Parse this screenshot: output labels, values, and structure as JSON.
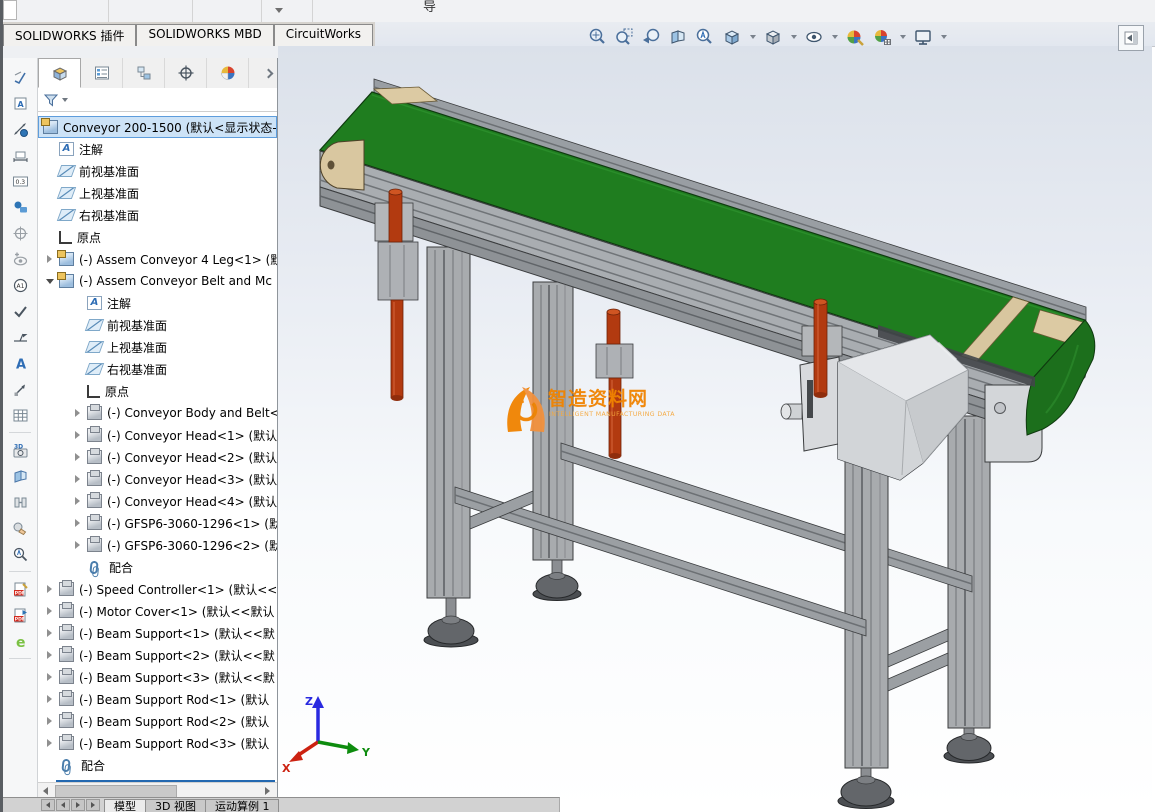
{
  "topbar": {
    "hint_char": "导"
  },
  "ribbon_tabs": [
    {
      "label": "SOLIDWORKS 插件"
    },
    {
      "label": "SOLIDWORKS MBD"
    },
    {
      "label": "CircuitWorks"
    }
  ],
  "tree": {
    "items": [
      {
        "label": "Conveyor 200-1500 (默认<显示状态-"
      },
      {
        "label": "注解"
      },
      {
        "label": "前视基准面"
      },
      {
        "label": "上视基准面"
      },
      {
        "label": "右视基准面"
      },
      {
        "label": "原点"
      },
      {
        "label": "(-) Assem Conveyor 4 Leg<1> (默"
      },
      {
        "label": "(-) Assem Conveyor Belt and Mc"
      },
      {
        "label": "注解"
      },
      {
        "label": "前视基准面"
      },
      {
        "label": "上视基准面"
      },
      {
        "label": "右视基准面"
      },
      {
        "label": "原点"
      },
      {
        "label": "(-) Conveyor Body and Belt<"
      },
      {
        "label": "(-) Conveyor Head<1> (默认"
      },
      {
        "label": "(-) Conveyor Head<2> (默认"
      },
      {
        "label": "(-) Conveyor Head<3> (默认"
      },
      {
        "label": "(-) Conveyor Head<4> (默认"
      },
      {
        "label": "(-) GFSP6-3060-1296<1> (默"
      },
      {
        "label": "(-) GFSP6-3060-1296<2> (默"
      },
      {
        "label": "配合"
      },
      {
        "label": "(-) Speed Controller<1> (默认<<"
      },
      {
        "label": "(-) Motor Cover<1> (默认<<默认"
      },
      {
        "label": "(-) Beam Support<1> (默认<<默"
      },
      {
        "label": "(-) Beam Support<2> (默认<<默"
      },
      {
        "label": "(-) Beam Support<3> (默认<<默"
      },
      {
        "label": "(-) Beam Support Rod<1> (默认"
      },
      {
        "label": "(-) Beam Support Rod<2> (默认"
      },
      {
        "label": "(-) Beam Support Rod<3> (默认"
      },
      {
        "label": "配合"
      }
    ]
  },
  "bottom_tabs": {
    "model": "模型",
    "view3d": "3D 视图",
    "motion": "运动算例 1"
  },
  "watermark": {
    "title": "智造资料网",
    "subtitle": "INTELLIGENT MANUFACTURING DATA"
  },
  "triad": {
    "x": "X",
    "y": "Y",
    "z": "Z"
  },
  "icons": {
    "ann_letter": "A",
    "tolerance_text": "0.3",
    "balloon_text": "A1",
    "big_a": "A",
    "pdf_text": "PDF",
    "threed_text": "3D",
    "edrawings_text": "e"
  },
  "colors": {
    "selection": "#cde3f7",
    "rollback_blue": "#2368b0",
    "belt_green": "#1f7d1f",
    "rod_red": "#b23a10",
    "tan": "#d9c7a0",
    "watermark_orange": "#f08300"
  }
}
